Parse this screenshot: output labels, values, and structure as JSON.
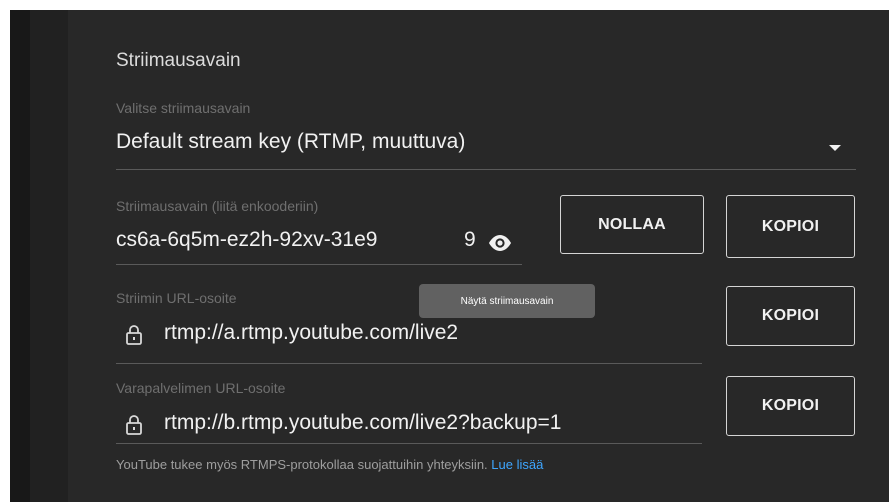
{
  "section": {
    "title": "Striimausavain"
  },
  "stream_key_select": {
    "label": "Valitse striimausavain",
    "value": "Default stream key (RTMP, muuttuva)",
    "icon": "dropdown-arrow-icon"
  },
  "stream_key": {
    "label": "Striimausavain (liitä enkooderiin)",
    "value": "cs6a-6q5m-ez2h-92xv-31e9",
    "trailing": "9",
    "icon": "eye-icon",
    "tooltip": "Näytä striimausavain",
    "reset_label": "NOLLAA",
    "copy_label": "KOPIOI"
  },
  "stream_url": {
    "label": "Striimin URL-osoite",
    "value": "rtmp://a.rtmp.youtube.com/live2",
    "icon": "lock-icon",
    "copy_label": "KOPIOI"
  },
  "backup_url": {
    "label": "Varapalvelimen URL-osoite",
    "value": "rtmp://b.rtmp.youtube.com/live2?backup=1",
    "icon": "lock-icon",
    "copy_label": "KOPIOI"
  },
  "footer": {
    "text": "YouTube tukee myös RTMPS-protokollaa suojattuihin yhteyksiin.",
    "link": "Lue lisää"
  },
  "colors": {
    "background": "#282828",
    "text": "#f1f1f1",
    "label": "#6f6f6f",
    "link": "#3ea6ff",
    "tooltip": "#616161"
  }
}
